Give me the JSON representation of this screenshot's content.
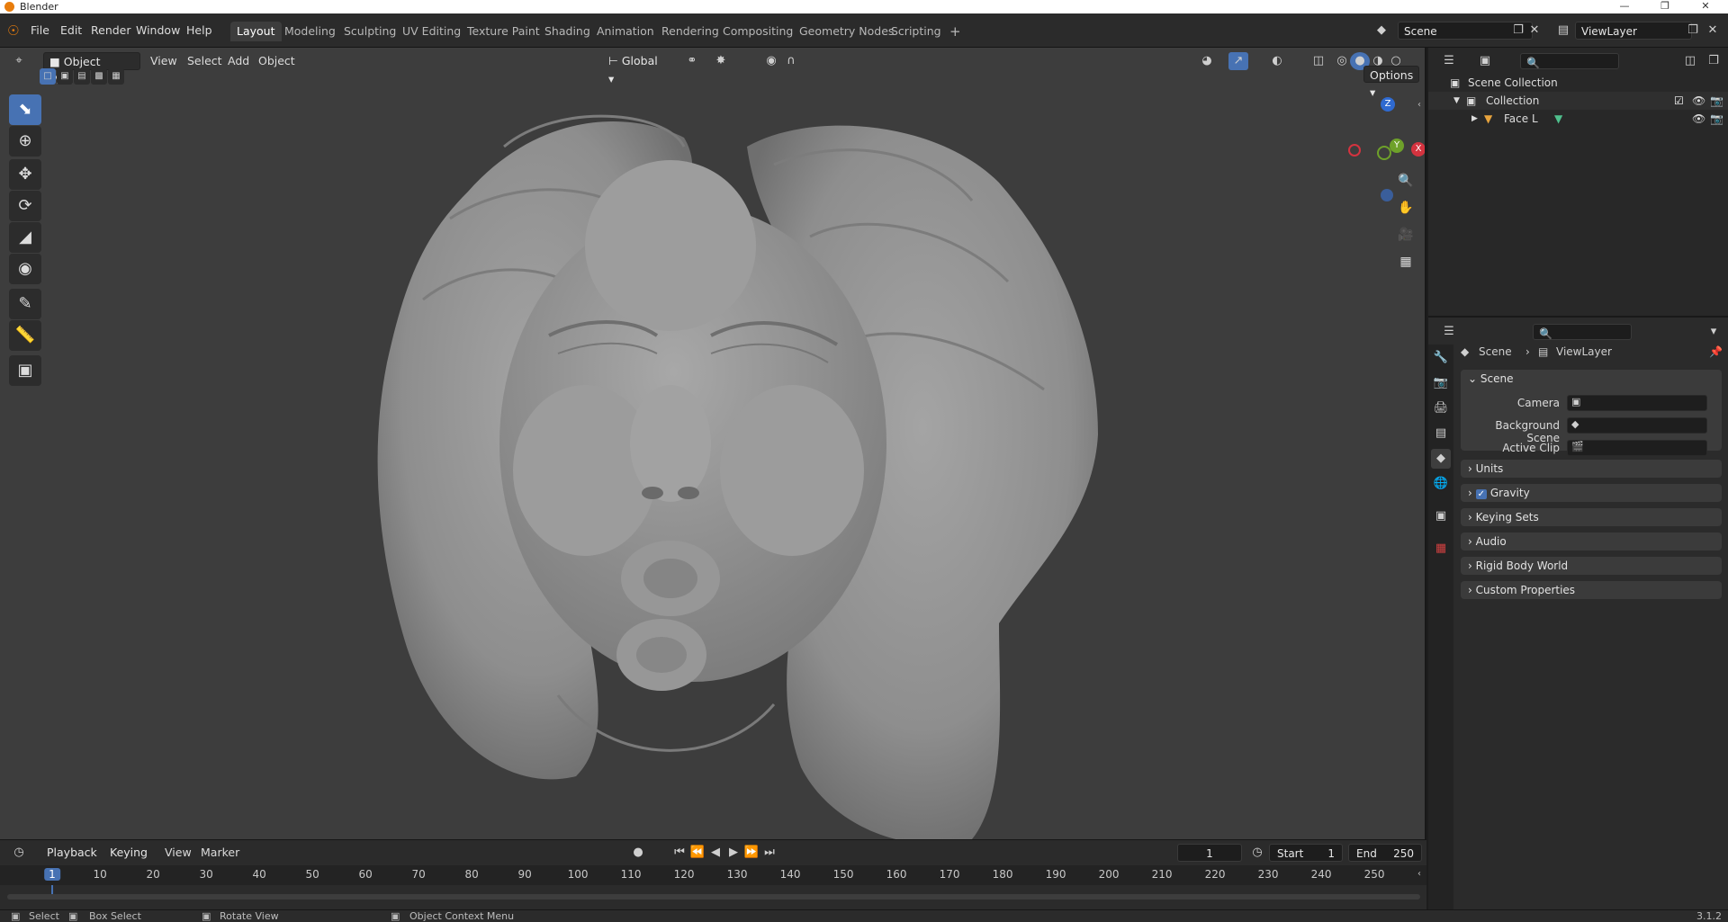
{
  "window": {
    "title": "Blender",
    "minimize": "—",
    "maximize": "❐",
    "close": "✕"
  },
  "menu": [
    "File",
    "Edit",
    "Render",
    "Window",
    "Help"
  ],
  "workspaces": {
    "tabs": [
      "Layout",
      "Modeling",
      "Sculpting",
      "UV Editing",
      "Texture Paint",
      "Shading",
      "Animation",
      "Rendering",
      "Compositing",
      "Geometry Nodes",
      "Scripting"
    ],
    "active": "Layout",
    "add": "+"
  },
  "scene_selector": {
    "value": "Scene"
  },
  "viewlayer_selector": {
    "value": "ViewLayer"
  },
  "viewport": {
    "mode": "Object Mode",
    "menus": [
      "View",
      "Select",
      "Add",
      "Object"
    ],
    "transform_orientation": "Global",
    "options_label": "Options",
    "gizmo_axes": {
      "z": "Z",
      "y": "Y",
      "x": "X"
    },
    "background": "#3d3d3d",
    "model_color": "#9a9a9a"
  },
  "timeline": {
    "menus": [
      "Playback",
      "Keying",
      "View",
      "Marker"
    ],
    "current_frame": "1",
    "start_label": "Start",
    "start_value": "1",
    "end_label": "End",
    "end_value": "250",
    "ticks": [
      "1",
      "10",
      "20",
      "30",
      "40",
      "50",
      "60",
      "70",
      "80",
      "90",
      "100",
      "110",
      "120",
      "130",
      "140",
      "150",
      "160",
      "170",
      "180",
      "190",
      "200",
      "210",
      "220",
      "230",
      "240",
      "250"
    ]
  },
  "outliner": {
    "scene_collection": "Scene Collection",
    "collection": "Collection",
    "object": "Face L"
  },
  "properties": {
    "breadcrumb": [
      "Scene",
      "ViewLayer"
    ],
    "panel_title": "Scene",
    "fields": [
      {
        "label": "Camera"
      },
      {
        "label": "Background Scene"
      },
      {
        "label": "Active Clip"
      }
    ],
    "sections": [
      "Units",
      "Gravity",
      "Keying Sets",
      "Audio",
      "Rigid Body World",
      "Custom Properties"
    ],
    "gravity_checked": true
  },
  "statusbar": {
    "select": "Select",
    "box_select": "Box Select",
    "rotate_view": "Rotate View",
    "context_menu": "Object Context Menu",
    "version": "3.1.2"
  },
  "colors": {
    "accent": "#4772b3",
    "blender_orange": "#e87d0d"
  }
}
